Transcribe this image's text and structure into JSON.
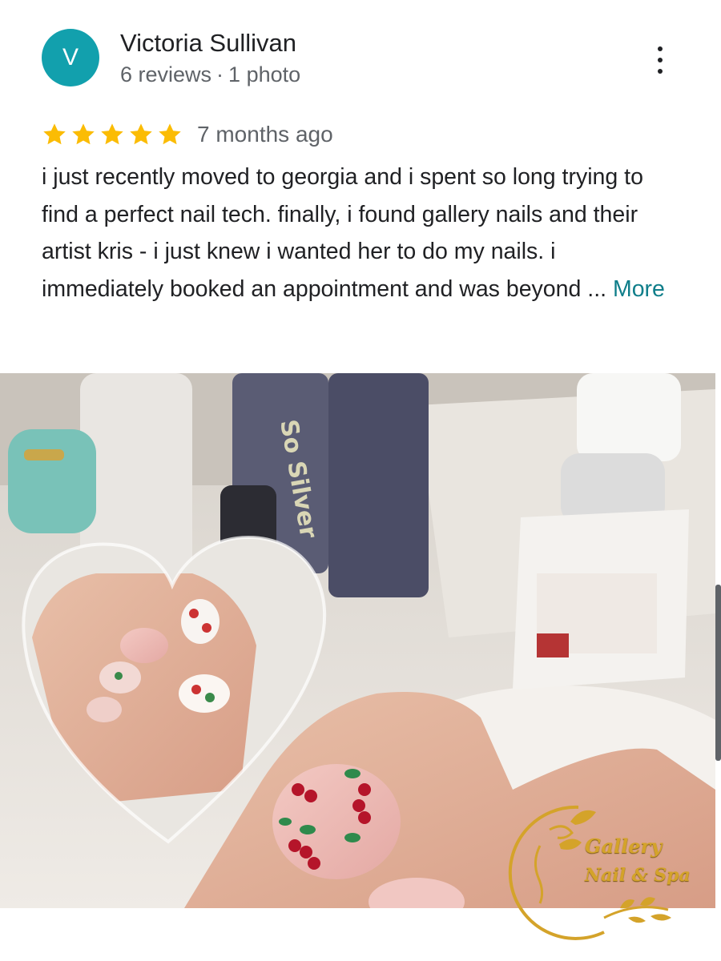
{
  "reviewer": {
    "avatar_letter": "V",
    "name": "Victoria Sullivan",
    "reviews_count": "6 reviews",
    "separator": "·",
    "photos_count": "1 photo"
  },
  "review": {
    "rating": 5,
    "rating_max": 5,
    "time": "7 months ago",
    "text": "i just recently moved to georgia and i spent so long trying to find a perfect nail tech. finally, i found gallery nails and their artist kris - i just knew i wanted her to do my nails. i immediately booked an appointment and was beyond ...",
    "more_label": "More"
  },
  "icons": {
    "more_menu": "more-vert-icon",
    "star": "star-icon"
  },
  "logo": {
    "line1": "Gallery",
    "line2": "Nail & Spa"
  },
  "colors": {
    "avatar": "#12a0ad",
    "star": "#fbbc04",
    "link": "#0f7e8a",
    "meta_text": "#5f6368",
    "logo_gold": "#d4a32a"
  }
}
